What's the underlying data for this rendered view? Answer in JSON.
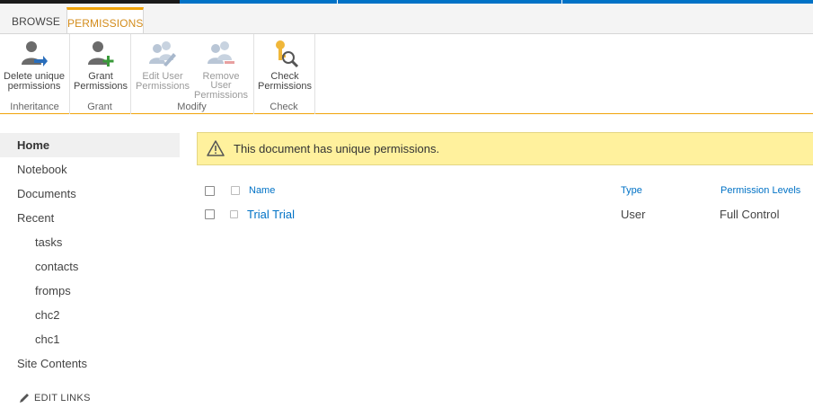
{
  "tabs": {
    "browse": "BROWSE",
    "permissions": "PERMISSIONS"
  },
  "ribbon": {
    "groups": {
      "inheritance": "Inheritance",
      "grant": "Grant",
      "modify": "Modify",
      "check": "Check"
    },
    "buttons": {
      "delete_unique_line1": "Delete unique",
      "delete_unique_line2": "permissions",
      "grant_line1": "Grant",
      "grant_line2": "Permissions",
      "edit_user_line1": "Edit User",
      "edit_user_line2": "Permissions",
      "remove_user_line1": "Remove User",
      "remove_user_line2": "Permissions",
      "check_line1": "Check",
      "check_line2": "Permissions"
    }
  },
  "nav": {
    "home": "Home",
    "notebook": "Notebook",
    "documents": "Documents",
    "recent": "Recent",
    "recent_items": [
      "tasks",
      "contacts",
      "fromps",
      "chc2",
      "chc1"
    ],
    "site_contents": "Site Contents",
    "edit_links": "EDIT LINKS"
  },
  "banner": {
    "message": "This document has unique permissions."
  },
  "table": {
    "headers": {
      "name": "Name",
      "type": "Type",
      "permission_levels": "Permission Levels"
    },
    "rows": [
      {
        "name": "Trial Trial",
        "type": "User",
        "permission_levels": "Full Control"
      }
    ]
  },
  "colors": {
    "accent_orange": "#f0a30a",
    "link_blue": "#0072c6",
    "banner_yellow": "#fff19d",
    "top_strip": "#0072c6"
  }
}
